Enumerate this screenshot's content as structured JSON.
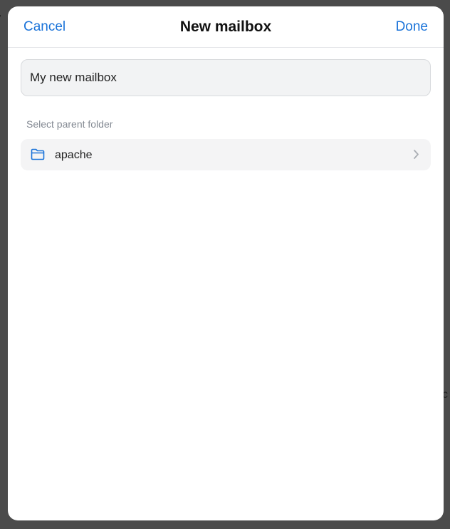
{
  "dialog": {
    "title": "New mailbox",
    "cancel_label": "Cancel",
    "done_label": "Done"
  },
  "name_field": {
    "value": "My new mailbox"
  },
  "parent_folder": {
    "section_label": "Select parent folder",
    "selected_folder": "apache",
    "folder_icon": "folder-icon",
    "chevron_icon": "chevron-right-icon"
  },
  "colors": {
    "accent": "#1a73d9",
    "backdrop": "#4b4b4b",
    "field_bg": "#f2f3f4",
    "muted_text": "#848a93"
  }
}
